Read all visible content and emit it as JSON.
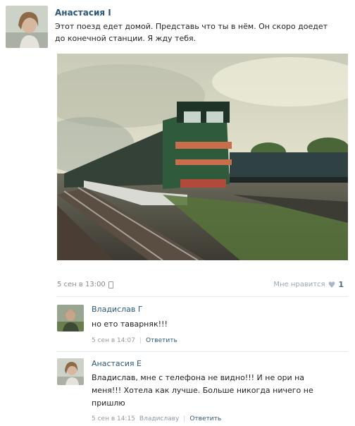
{
  "post": {
    "author": "Анастасия І",
    "text": "Этот поезд едет домой. Представь что ты в нём. Он скоро доедет до конечной станции. Я жду тебя.",
    "date": "5 сен в 13:00",
    "like_label": "Мне нравится",
    "like_count": "1"
  },
  "comments": [
    {
      "author": "Владислав Г",
      "text": "но ето таварняк!!!",
      "date": "5 сен в 14:07",
      "reply_label": "Ответить"
    },
    {
      "author": "Анастасия Е",
      "text": "Владислав, мне с телефона не видно!!! И не ори на меня!!! Хотела как лучше. Больше никогда ничего не пришлю",
      "date": "5 сен в 14:15",
      "reply_to": "Владиславу",
      "reply_label": "Ответить"
    }
  ]
}
